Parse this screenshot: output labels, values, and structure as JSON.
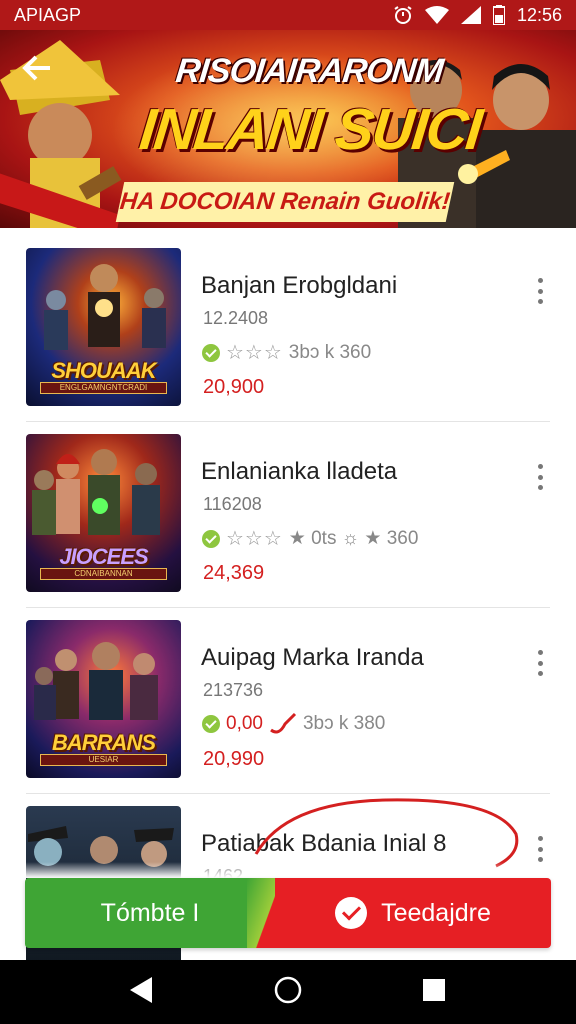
{
  "status_bar": {
    "carrier": "APIAGP",
    "time": "12:56"
  },
  "banner": {
    "line1": "RISOIAIRARONM",
    "line2": "INLANI SUICI",
    "line3": "HA DOCOIAN Renain Guolik!"
  },
  "items": [
    {
      "title": "Banjan Erobgldani",
      "subtitle": "12.2408",
      "meta_text": "3bɔ k 360",
      "price": "20,900",
      "thumb_title": "SHOUAAK",
      "thumb_sub": "ENGLGAMNGNTCRADI"
    },
    {
      "title": "Enlanianka lladeta",
      "subtitle": "116208",
      "meta_text": "★ 0ts ☼ ★ 360",
      "price": "24,369",
      "thumb_title": "JIOCEES",
      "thumb_sub": "CDNAIBANNAN"
    },
    {
      "title": "Auipag Marka Iranda",
      "subtitle": "213736",
      "meta_text": "3bɔ k 380",
      "price": "20,990",
      "meta_price": "0,00",
      "thumb_title": "BARRANS",
      "thumb_sub": "UESIAR"
    },
    {
      "title": "Patiabak Bdania Inial 8",
      "subtitle": "1462",
      "meta_text": "",
      "price": "",
      "thumb_title": "",
      "thumb_sub": ""
    }
  ],
  "actions": {
    "left_label": "Tómbte I",
    "right_label": "Teedajdre"
  },
  "colors": {
    "accent_red": "#e61f24",
    "accent_green": "#3fa535",
    "price_red": "#d42020"
  },
  "icons": [
    "back-arrow-icon",
    "alarm-icon",
    "wifi-icon",
    "signal-icon",
    "battery-icon",
    "kebab-menu-icon",
    "check-icon",
    "nav-back-icon",
    "nav-home-icon",
    "nav-recents-icon"
  ]
}
